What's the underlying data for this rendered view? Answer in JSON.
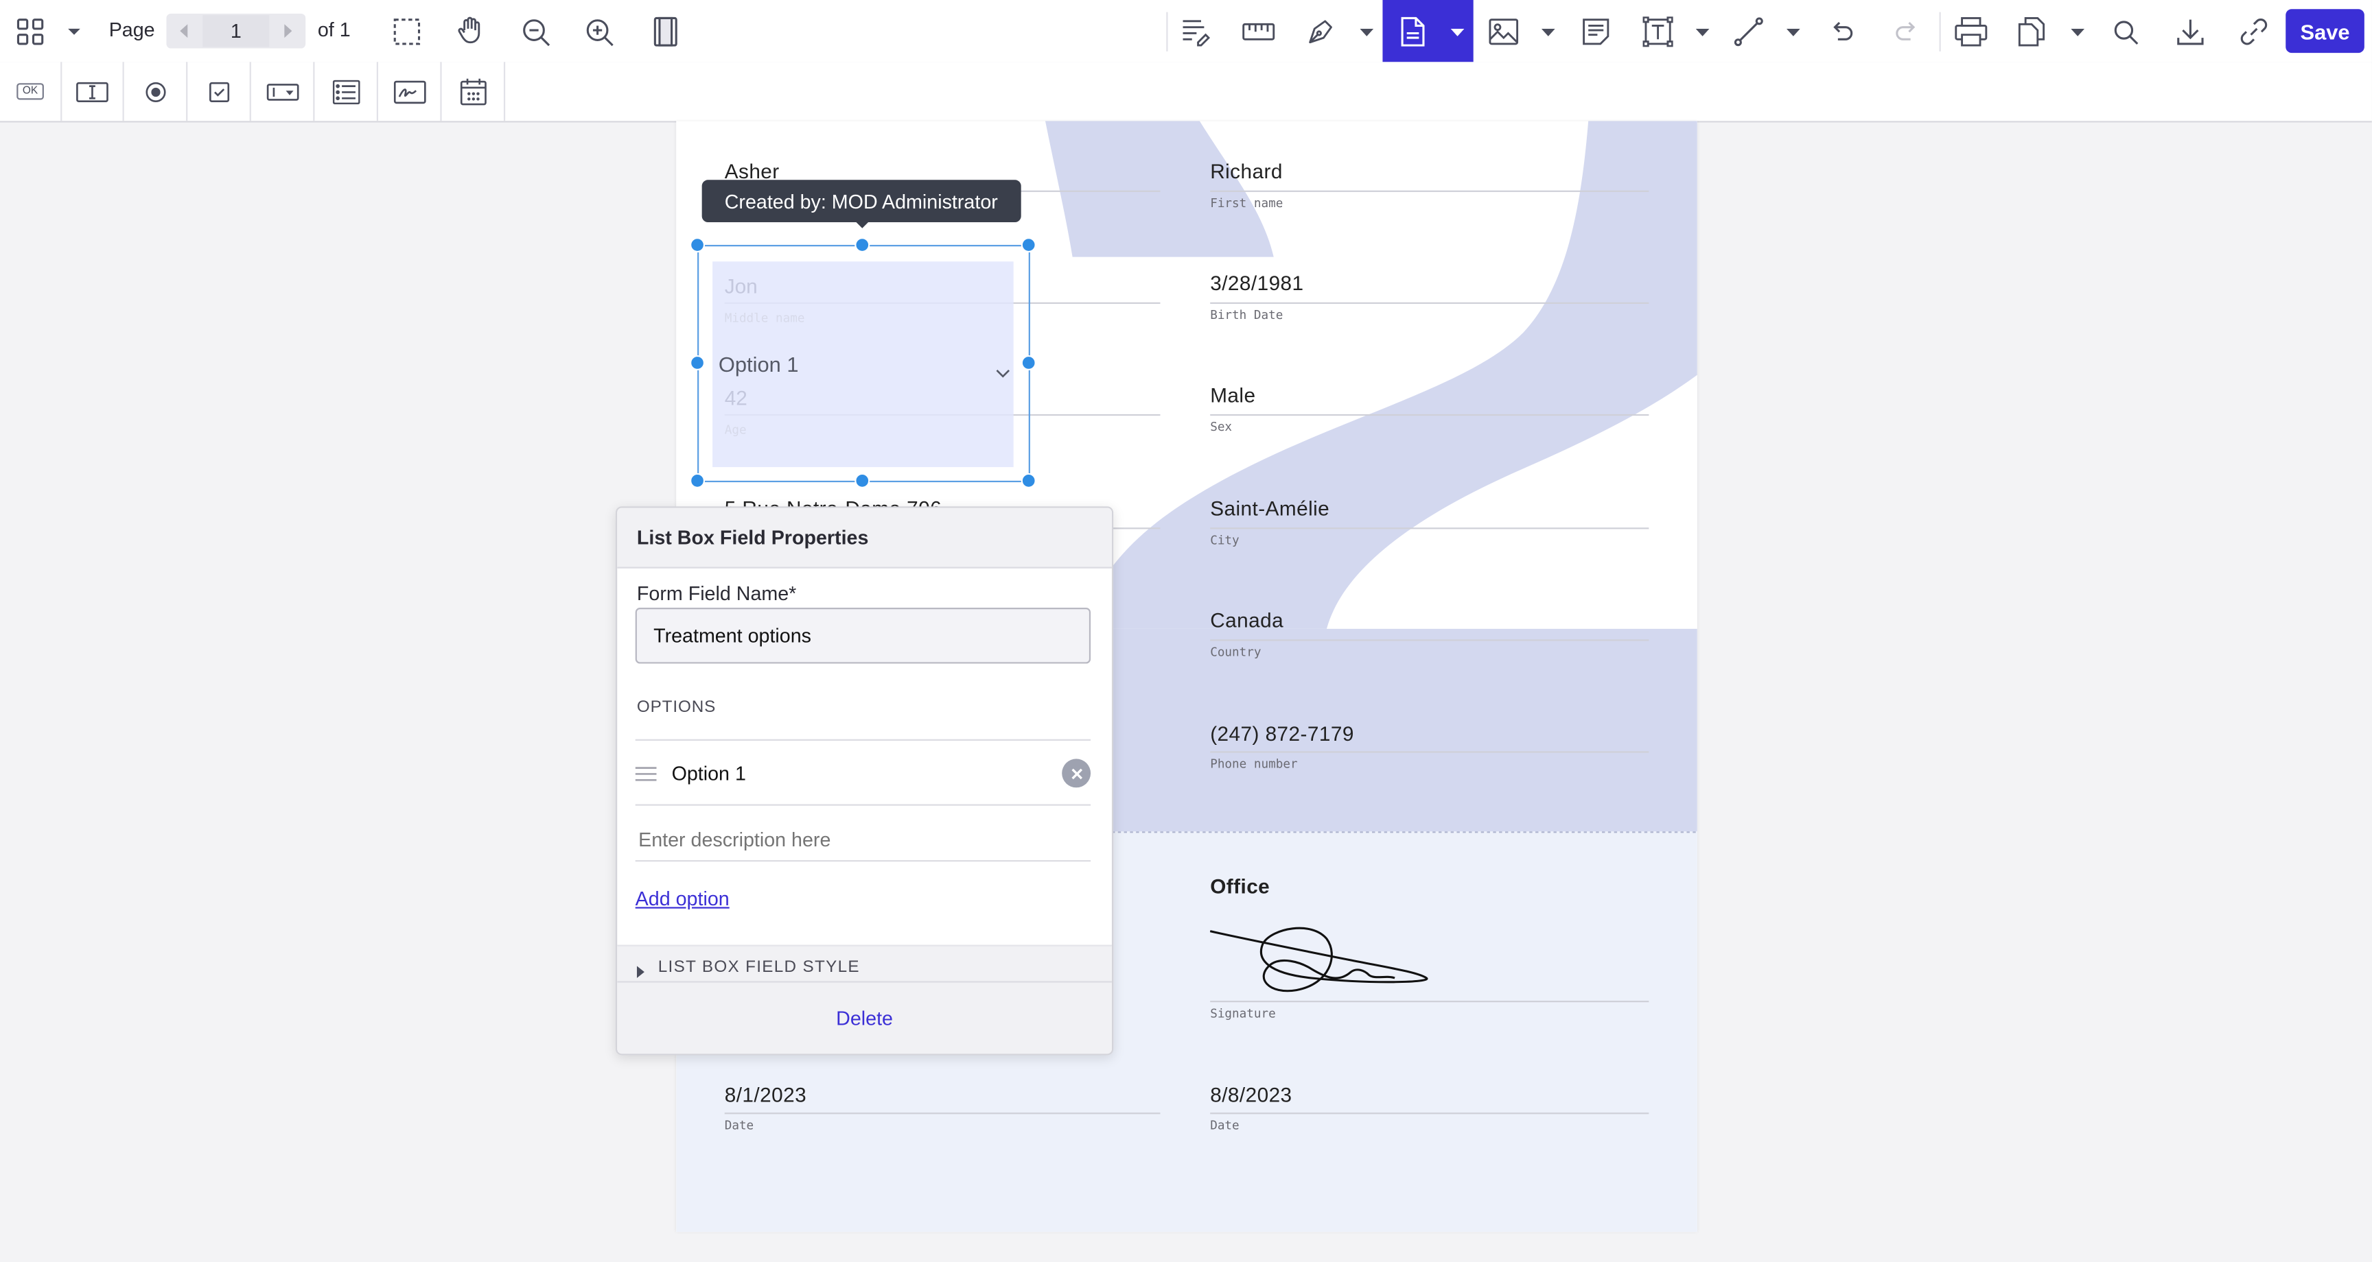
{
  "toolbar": {
    "page_label": "Page",
    "page_number": "1",
    "page_total": "of 1",
    "save_label": "Save",
    "icons": [
      "sidebar-grid-icon",
      "chevron-down-icon",
      "chevron-left-icon",
      "chevron-right-icon",
      "marquee-select-icon",
      "pan-hand-icon",
      "zoom-out-icon",
      "zoom-in-icon",
      "page-layout-icon",
      "text-select-icon",
      "ruler-icon",
      "ink-pen-icon",
      "form-field-icon",
      "image-icon",
      "note-icon",
      "text-box-icon",
      "line-icon",
      "undo-icon",
      "redo-icon",
      "print-icon",
      "document-editor-icon",
      "search-icon",
      "download-icon",
      "link-icon"
    ]
  },
  "form_toolbar": {
    "button_label": "OK",
    "icons": [
      "button-field-icon",
      "text-field-icon",
      "radio-field-icon",
      "checkbox-field-icon",
      "combo-box-icon",
      "list-box-icon",
      "signature-field-icon",
      "date-field-icon"
    ]
  },
  "document": {
    "left_first": "Asher",
    "right_fields": [
      {
        "value": "Richard",
        "label": "First name"
      },
      {
        "value": "3/28/1981",
        "label": "Birth Date"
      },
      {
        "value": "Male",
        "label": "Sex"
      },
      {
        "value": "Saint-Amélie",
        "label": "City"
      },
      {
        "value": "Canada",
        "label": "Country"
      },
      {
        "value": "(247) 872-7179",
        "label": "Phone number"
      }
    ],
    "behind_field": {
      "value1": "Jon",
      "label1": "Middle name",
      "value2": "42",
      "label2": "Age"
    },
    "partial_text": "5 Rue Notre-Dame 706",
    "office_heading": "Office",
    "signature_label": "Signature",
    "dates": [
      {
        "value": "8/1/2023",
        "label": "Date"
      },
      {
        "value": "8/8/2023",
        "label": "Date"
      }
    ]
  },
  "listbox": {
    "tooltip": "Created by: MOD Administrator",
    "selected_option": "Option 1"
  },
  "properties": {
    "title": "List Box Field Properties",
    "name_label": "Form Field Name*",
    "name_value": "Treatment options",
    "options_heading": "OPTIONS",
    "options": [
      "Option 1"
    ],
    "description_placeholder": "Enter description here",
    "add_option_label": "Add option",
    "style_section_label": "LIST BOX FIELD STYLE",
    "delete_label": "Delete"
  },
  "colors": {
    "accent": "#3b2fd6",
    "selection": "#2f8de4",
    "page_band": "#d3d8ef",
    "page_band_light": "#edf1fa",
    "tooltip_bg": "#3a3f4b"
  }
}
